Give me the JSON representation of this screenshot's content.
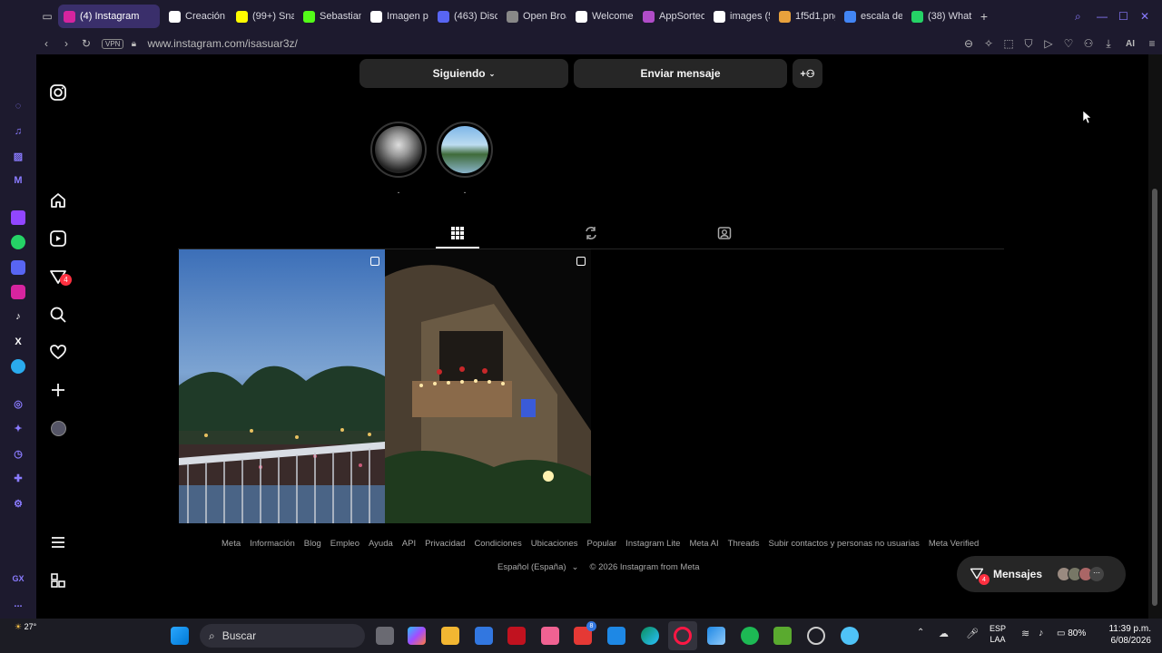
{
  "browser": {
    "tabs": [
      {
        "label": "(4) Instagram",
        "active": true,
        "icon": "instagram-icon",
        "color": "#d6249f"
      },
      {
        "label": "Creación c",
        "icon": "document-icon",
        "color": "#ffffff"
      },
      {
        "label": "(99+) Sna",
        "icon": "snapchat-icon",
        "color": "#fffc00"
      },
      {
        "label": "Sebastian",
        "icon": "kick-icon",
        "color": "#53fc18"
      },
      {
        "label": "Imagen pa",
        "icon": "openai-icon",
        "color": "#ffffff"
      },
      {
        "label": "(463) Disc",
        "icon": "discord-icon",
        "color": "#5865f2"
      },
      {
        "label": "Open Broa",
        "icon": "obs-icon",
        "color": "#888888"
      },
      {
        "label": "Welcome",
        "icon": "document-icon",
        "color": "#ffffff"
      },
      {
        "label": "AppSorteo",
        "icon": "app-icon",
        "color": "#b04cc8"
      },
      {
        "label": "images (5",
        "icon": "document-icon",
        "color": "#ffffff"
      },
      {
        "label": "1f5d1.png",
        "icon": "image-icon",
        "color": "#e8a13c"
      },
      {
        "label": "escala de",
        "icon": "google-icon",
        "color": "#4285f4"
      },
      {
        "label": "(38) What",
        "icon": "whatsapp-icon",
        "color": "#25d366"
      }
    ],
    "vpn_label": "VPN",
    "url": "www.instagram.com/isasuar3z/",
    "ai_label": "AI"
  },
  "opera_sidebar": {
    "items": [
      "aria-icon",
      "music-icon",
      "crypto-icon",
      "messenger-icon",
      "twitch-icon",
      "whatsapp-icon",
      "discord-icon",
      "instagram-icon",
      "tiktok-icon",
      "x-icon",
      "telegram-icon",
      "player-icon",
      "pin-icon",
      "history-icon",
      "extensions-icon",
      "settings-icon"
    ],
    "gx_label": "GX",
    "more_label": "..."
  },
  "ig_nav": {
    "notification_badge": "4"
  },
  "profile": {
    "following_label": "Siguiendo",
    "message_label": "Enviar mensaje",
    "highlights": [
      {
        "label": "."
      },
      {
        "label": "."
      }
    ]
  },
  "footer": {
    "links": [
      "Meta",
      "Información",
      "Blog",
      "Empleo",
      "Ayuda",
      "API",
      "Privacidad",
      "Condiciones",
      "Ubicaciones",
      "Popular",
      "Instagram Lite",
      "Meta AI",
      "Threads",
      "Subir contactos y personas no usuarias",
      "Meta Verified"
    ],
    "language": "Español (España)",
    "copyright": "© 2026 Instagram from Meta"
  },
  "messages": {
    "label": "Mensajes",
    "badge": "4"
  },
  "taskbar": {
    "weather": "27°",
    "search_placeholder": "Buscar",
    "lang_top": "ESP",
    "lang_bottom": "LAA",
    "battery": "80%",
    "time": "11:39 p.m.",
    "date": "6/08/2026",
    "badge": "8"
  }
}
